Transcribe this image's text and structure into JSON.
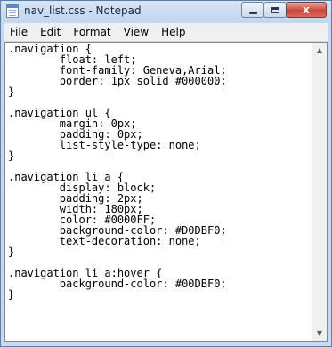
{
  "window": {
    "title": "nav_list.css - Notepad",
    "controls": {
      "minimize": "",
      "maximize": "",
      "close": "x"
    }
  },
  "menu": {
    "items": [
      {
        "label": "File"
      },
      {
        "label": "Edit"
      },
      {
        "label": "Format"
      },
      {
        "label": "View"
      },
      {
        "label": "Help"
      }
    ]
  },
  "editor": {
    "content": ".navigation {\n        float: left;\n        font-family: Geneva,Arial;\n        border: 1px solid #000000;\n}\n\n.navigation ul {\n        margin: 0px;\n        padding: 0px;\n        list-style-type: none;\n}\n\n.navigation li a {\n        display: block;\n        padding: 2px;\n        width: 180px;\n        color: #0000FF;\n        background-color: #D0DBF0;\n        text-decoration: none;\n}\n\n.navigation li a:hover {\n        background-color: #00DBF0;\n}"
  },
  "scrollbar": {
    "up_icon": "▲",
    "down_icon": "▼"
  },
  "colors": {
    "accent": "#4d8ed6",
    "window_frame": "#c9daee",
    "close_button": "#c9453a"
  }
}
